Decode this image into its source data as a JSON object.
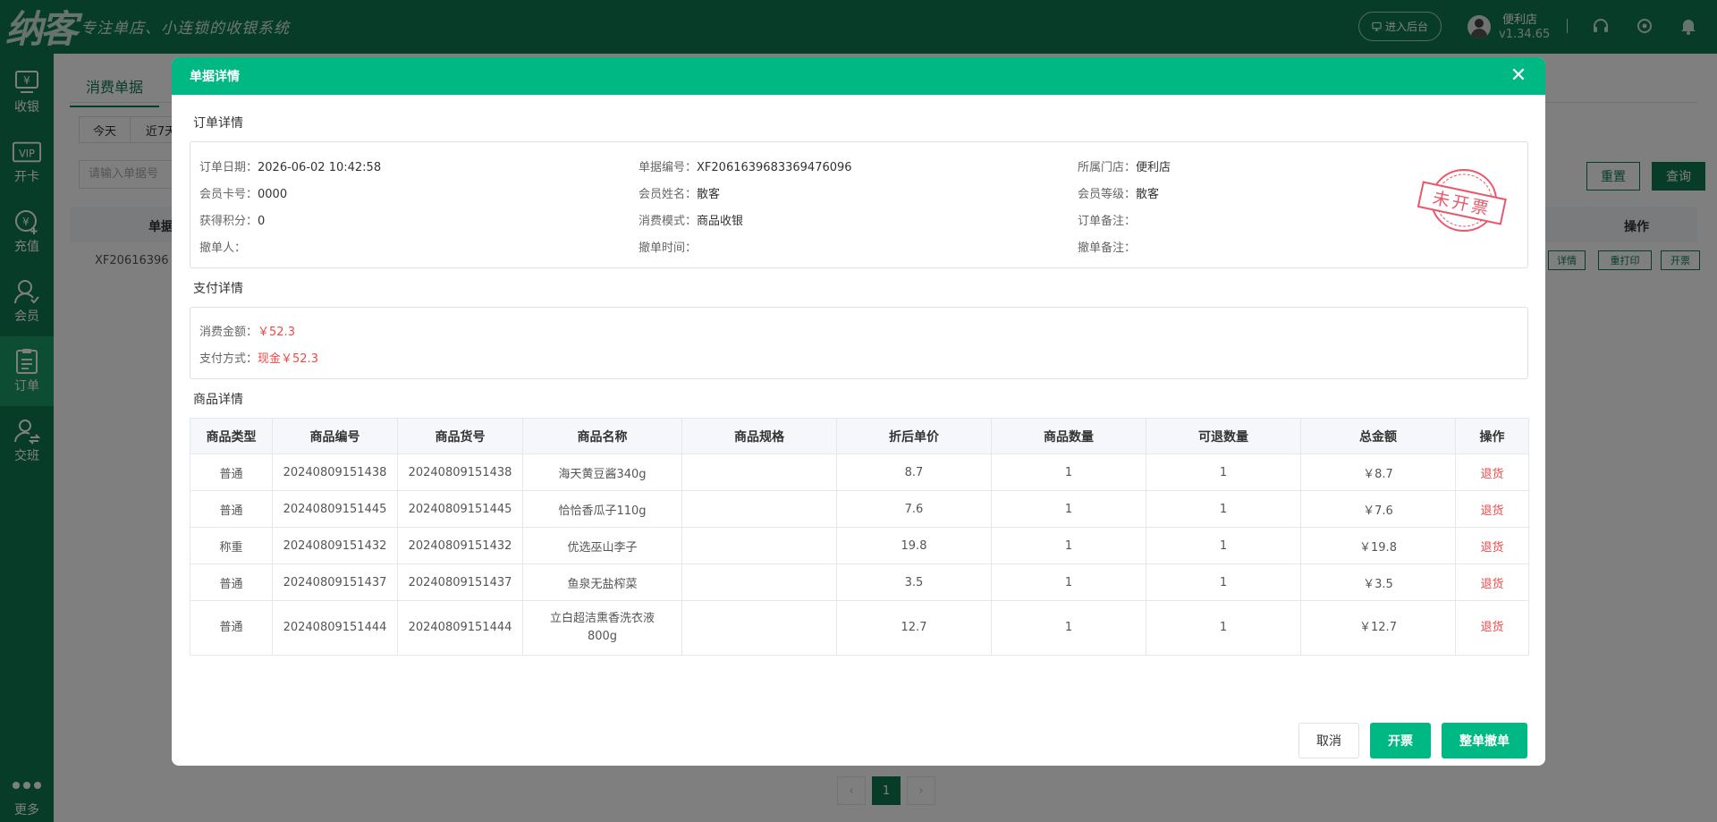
{
  "topbar": {
    "logo_mark": "纳客",
    "logo_slogan": "专注单店、小连锁的收银系统",
    "enter_admin_label": "进入后台",
    "store_name": "便利店",
    "version": "v1.34.65"
  },
  "sidebar": {
    "items": [
      {
        "label": "收银",
        "icon": "cashier-icon"
      },
      {
        "label": "开卡",
        "icon": "vip-card-icon"
      },
      {
        "label": "充值",
        "icon": "recharge-icon"
      },
      {
        "label": "会员",
        "icon": "member-icon"
      },
      {
        "label": "订单",
        "icon": "order-icon"
      },
      {
        "label": "交班",
        "icon": "shift-icon"
      }
    ],
    "more_label": "更多"
  },
  "background": {
    "tab_label": "消费单据",
    "today_label": "今天",
    "last7_label": "近7天",
    "search_placeholder": "请输入单据号",
    "reset_label": "重置",
    "query_label": "查询",
    "col_order_no": "单据",
    "col_action": "操作",
    "row_order_no": "XF20616396",
    "row_btn_detail": "详情",
    "row_btn_reprint": "重打印",
    "row_btn_invoice": "开票",
    "pager_prev": "‹",
    "pager_current": "1",
    "pager_next": "›"
  },
  "modal": {
    "title": "单据详情",
    "close_icon": "close-icon",
    "order_section_title": "订单详情",
    "order_info": {
      "order_date_label": "订单日期：",
      "order_date": "2026-06-02 10:42:58",
      "order_no_label": "单据编号：",
      "order_no": "XF2061639683369476096",
      "store_label": "所属门店：",
      "store": "便利店",
      "card_no_label": "会员卡号：",
      "card_no": "0000",
      "member_name_label": "会员姓名：",
      "member_name": "散客",
      "member_level_label": "会员等级：",
      "member_level": "散客",
      "points_label": "获得积分：",
      "points": "0",
      "mode_label": "消费模式：",
      "mode": "商品收银",
      "remark_label": "订单备注：",
      "remark": "",
      "revoker_label": "撤单人：",
      "revoker": "",
      "revoke_time_label": "撤单时间：",
      "revoke_time": "",
      "revoke_remark_label": "撤单备注：",
      "revoke_remark": ""
    },
    "stamp_text": "未开票",
    "payment_section_title": "支付详情",
    "payment": {
      "amount_label": "消费金额：",
      "amount": "￥52.3",
      "method_label": "支付方式：",
      "method": "现金￥52.3"
    },
    "goods_section_title": "商品详情",
    "goods_columns": [
      "商品类型",
      "商品编号",
      "商品货号",
      "商品名称",
      "商品规格",
      "折后单价",
      "商品数量",
      "可退数量",
      "总金额",
      "操作"
    ],
    "goods_rows": [
      {
        "type": "普通",
        "code": "20240809151438",
        "sku": "20240809151438",
        "name": "海天黄豆酱340g",
        "spec": "",
        "price": "8.7",
        "qty": "1",
        "refundable": "1",
        "total": "￥8.7",
        "action": "退货"
      },
      {
        "type": "普通",
        "code": "20240809151445",
        "sku": "20240809151445",
        "name": "恰恰香瓜子110g",
        "spec": "",
        "price": "7.6",
        "qty": "1",
        "refundable": "1",
        "total": "￥7.6",
        "action": "退货"
      },
      {
        "type": "称重",
        "code": "20240809151432",
        "sku": "20240809151432",
        "name": "优选巫山李子",
        "spec": "",
        "price": "19.8",
        "qty": "1",
        "refundable": "1",
        "total": "￥19.8",
        "action": "退货"
      },
      {
        "type": "普通",
        "code": "20240809151437",
        "sku": "20240809151437",
        "name": "鱼泉无盐榨菜",
        "spec": "",
        "price": "3.5",
        "qty": "1",
        "refundable": "1",
        "total": "￥3.5",
        "action": "退货"
      },
      {
        "type": "普通",
        "code": "20240809151444",
        "sku": "20240809151444",
        "name": "立白超洁熏香洗衣液800g",
        "spec": "",
        "price": "12.7",
        "qty": "1",
        "refundable": "1",
        "total": "￥12.7",
        "action": "退货"
      }
    ],
    "cancel_label": "取消",
    "invoice_label": "开票",
    "revoke_all_label": "整单撤单"
  },
  "colors": {
    "brand_dark": "#0e7a50",
    "brand": "#00b884",
    "danger": "#f04848"
  }
}
